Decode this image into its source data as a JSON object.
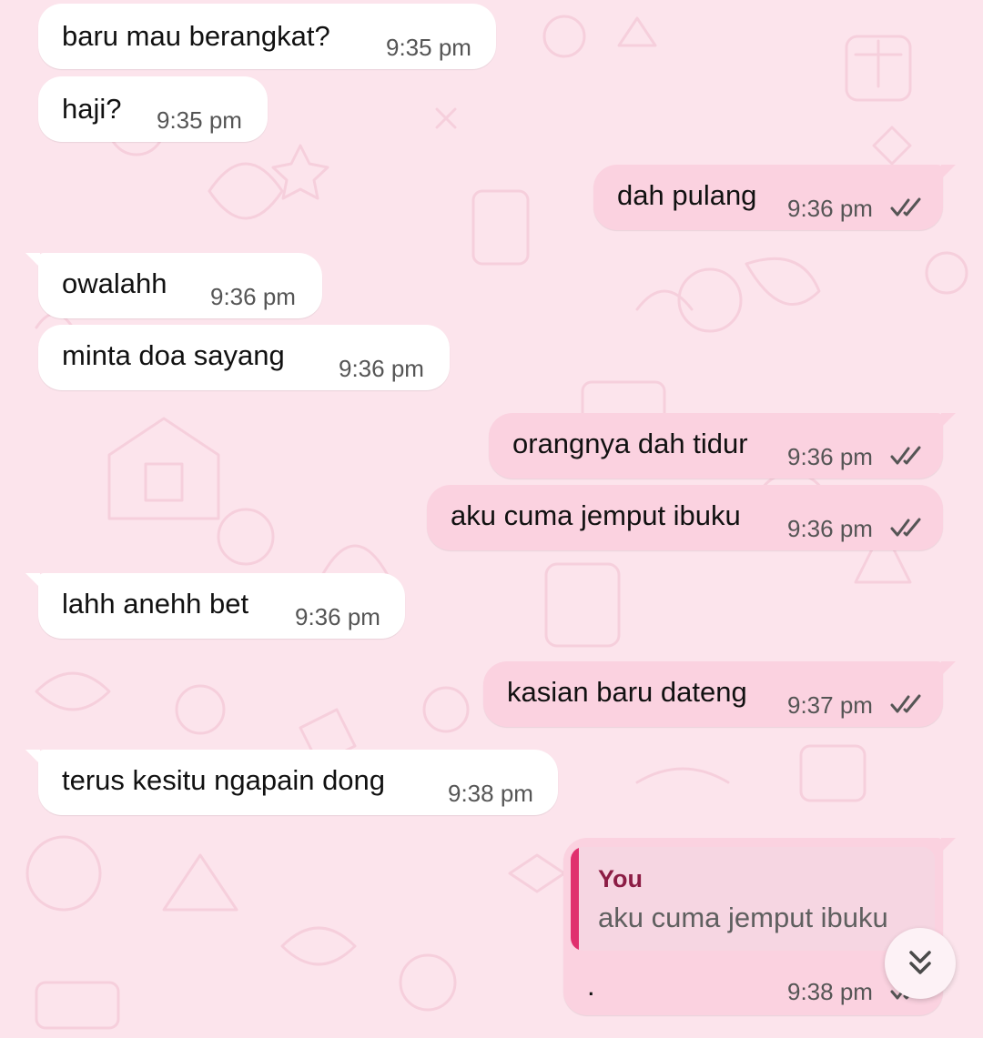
{
  "messages": [
    {
      "direction": "in",
      "text": "baru mau berangkat?",
      "time": "9:35 pm"
    },
    {
      "direction": "in",
      "text": "haji?",
      "time": "9:35 pm"
    },
    {
      "direction": "out",
      "text": "dah pulang",
      "time": "9:36 pm",
      "status": "read"
    },
    {
      "direction": "in",
      "text": "owalahh",
      "time": "9:36 pm"
    },
    {
      "direction": "in",
      "text": "minta doa sayang",
      "time": "9:36 pm"
    },
    {
      "direction": "out",
      "text": "orangnya dah tidur",
      "time": "9:36 pm",
      "status": "read"
    },
    {
      "direction": "out",
      "text": "aku cuma jemput ibuku",
      "time": "9:36 pm",
      "status": "read"
    },
    {
      "direction": "in",
      "text": "lahh anehh bet",
      "time": "9:36 pm"
    },
    {
      "direction": "out",
      "text": "kasian baru dateng",
      "time": "9:37 pm",
      "status": "read"
    },
    {
      "direction": "in",
      "text": "terus kesitu ngapain dong",
      "time": "9:38 pm"
    },
    {
      "direction": "out",
      "reply": {
        "author": "You",
        "text": "aku cuma jemput ibuku"
      },
      "text": ".",
      "time": "9:38 pm",
      "status": "read"
    }
  ],
  "scroll_button": {
    "icon": "double-chevron-down-icon"
  },
  "colors": {
    "background": "#fce4ec",
    "incoming_bubble": "#ffffff",
    "outgoing_bubble": "#fbd2e0",
    "quote_accent": "#e0306e",
    "quote_author": "#8c1d45"
  }
}
